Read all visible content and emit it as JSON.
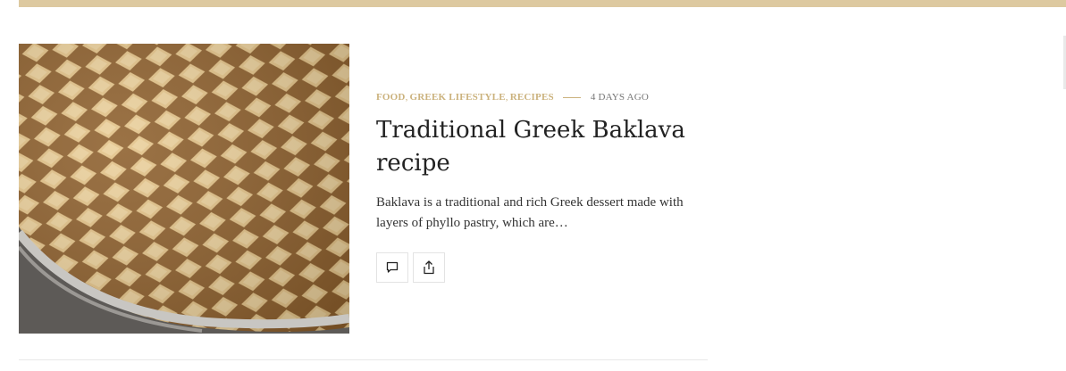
{
  "theme": {
    "accent": "#cbb27d",
    "top_bar": "#ddc9a0"
  },
  "post": {
    "image_alt": "Tray of baklava cut into diamonds",
    "categories": [
      {
        "label": "FOOD"
      },
      {
        "label": "GREEK LIFESTYLE"
      },
      {
        "label": "RECIPES"
      }
    ],
    "date": "4 DAYS AGO",
    "title": "Traditional Greek Baklava recipe",
    "excerpt": "Baklava is a traditional and rich Greek dessert made with layers of phyllo pastry, which are…",
    "actions": {
      "comment_icon": "comment-icon",
      "share_icon": "share-icon"
    }
  }
}
